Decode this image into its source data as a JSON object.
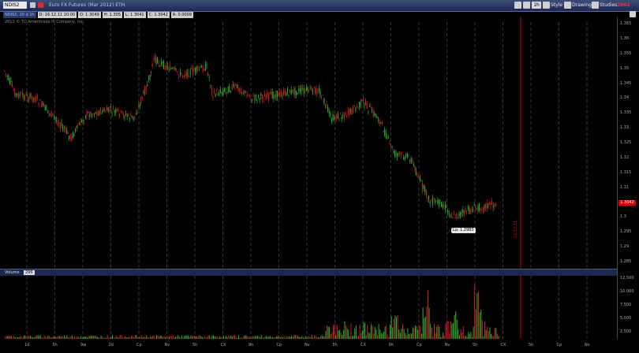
{
  "toolbar": {
    "symbol": "NDIS2",
    "title": "Euro FX Futures (Mar 2012) ETH",
    "timeframe": "1h",
    "style_label": "Style",
    "drawings_label": "Drawings",
    "studies_label": "Studies",
    "alert_label": "2062"
  },
  "infobar": {
    "series": "NDIS2, 20 d 1h",
    "date": "D: 16.12.11 10:00",
    "open": "O: 1.3049",
    "high": "H: 1.305",
    "low": "L: 1.3041",
    "close": "C: 1.3042",
    "range": "R: 0.0009"
  },
  "copyright": "2011 © TD Ameritrade IP Company, Inc.",
  "price_axis": [
    "1.365",
    "1.36",
    "1.355",
    "1.35",
    "1.345",
    "1.34",
    "1.335",
    "1.33",
    "1.325",
    "1.32",
    "1.315",
    "1.31",
    "1.305",
    "1.3",
    "1.295",
    "1.29",
    "1.285"
  ],
  "current_price": "1.3042",
  "low_label": "Lo: 1.2983",
  "vertical_marker": "16.12.11",
  "volume": {
    "label": "Volume",
    "value": "296",
    "axis": [
      "12,500",
      "10,000",
      "7,500",
      "5,000",
      "2,500"
    ]
  },
  "time_axis": [
    "1d",
    "5h",
    "9w",
    "2d",
    "Cp",
    "Nv",
    "5h",
    "CX",
    "9h",
    "Cp",
    "Nv",
    "5h",
    "CX",
    "9h",
    "Cp",
    "Nv",
    "5h",
    "CX",
    "5h",
    "Cp",
    "Nv"
  ],
  "colors": {
    "up": "#2fae2f",
    "down": "#d02020",
    "grid": "#555555",
    "marker": "#c00000"
  }
}
